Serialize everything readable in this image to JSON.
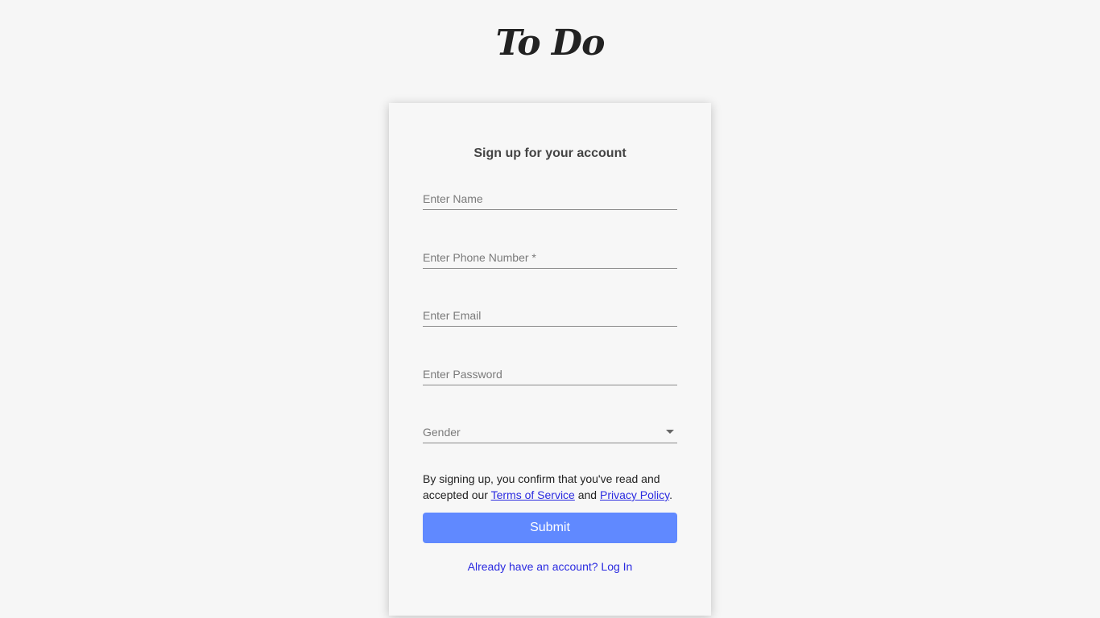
{
  "app": {
    "title": "To Do"
  },
  "form": {
    "title": "Sign up for your account",
    "fields": [
      {
        "placeholder": "Enter Name",
        "value": ""
      },
      {
        "placeholder": "Enter Phone Number *",
        "value": ""
      },
      {
        "placeholder": "Enter Email",
        "value": ""
      },
      {
        "placeholder": "Enter Password",
        "value": ""
      }
    ],
    "gender": {
      "label": "Gender",
      "icon": "caret-down-icon"
    },
    "terms": {
      "prefix": "By signing up, you confirm that you've read and accepted our ",
      "terms_link": "Terms of Service",
      "middle": " and ",
      "privacy_link": "Privacy Policy",
      "suffix": "."
    },
    "submit_label": "Submit",
    "login_link": "Already have an account? Log In"
  },
  "colors": {
    "accent": "#6089ff",
    "link": "#2a2ae0"
  }
}
